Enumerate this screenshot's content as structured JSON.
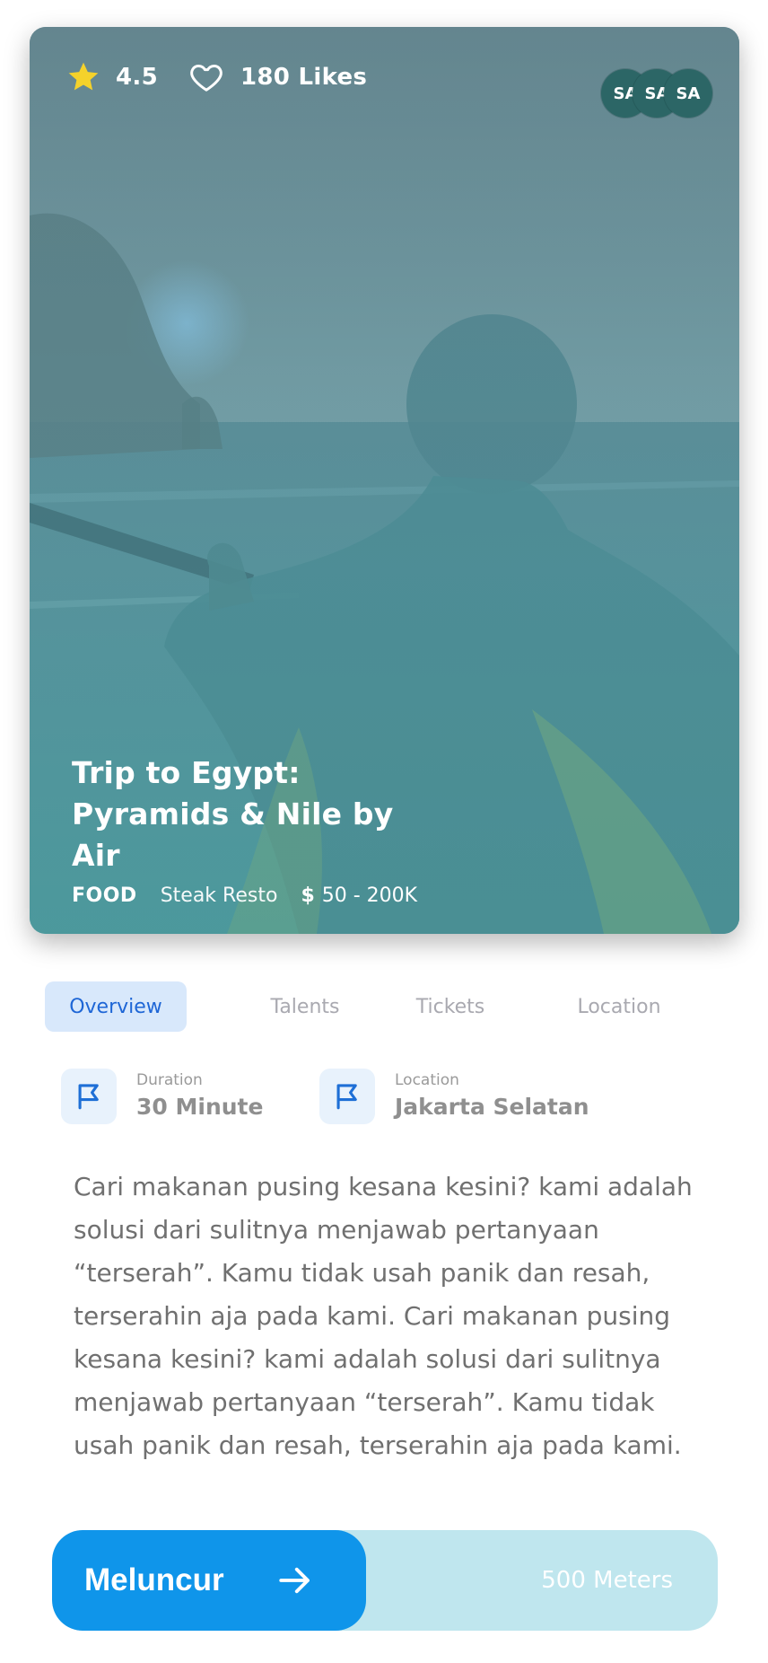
{
  "hero": {
    "rating": "4.5",
    "likes": "180 Likes",
    "avatars": [
      "SA",
      "SA",
      "SA"
    ],
    "title": "Trip to Egypt: Pyramids & Nile by Air",
    "category": "FOOD",
    "place": "Steak Resto",
    "currency_symbol": "$",
    "price_range": "50 - 200K"
  },
  "tabs": [
    {
      "label": "Overview",
      "active": true
    },
    {
      "label": "Talents",
      "active": false
    },
    {
      "label": "Tickets",
      "active": false
    },
    {
      "label": "Location",
      "active": false
    }
  ],
  "info": {
    "duration": {
      "label": "Duration",
      "value": "30 Minute"
    },
    "location": {
      "label": "Location",
      "value": "Jakarta Selatan"
    }
  },
  "description": "Cari makanan pusing kesana kesini? kami adalah solusi dari sulitnya menjawab pertanyaan “terserah”. Kamu tidak usah panik dan resah, terserahin aja pada kami. Cari makanan pusing kesana kesini? kami adalah solusi dari sulitnya menjawab pertanyaan “terserah”. Kamu tidak usah panik dan resah, terserahin aja pada kami.",
  "launch": {
    "button_label": "Meluncur",
    "distance": "500 Meters"
  },
  "icons": {
    "rating": "star-icon",
    "likes": "heart-icon",
    "info": "flag-icon",
    "launch": "arrow-right-icon"
  },
  "colors": {
    "accent": "#0f95ea",
    "tab_active_bg": "#d8e8fb",
    "tab_active_text": "#1e66d6",
    "star": "#f5d22b",
    "avatar_bg": "#2c6666",
    "launch_track": "#bfe6ee"
  }
}
